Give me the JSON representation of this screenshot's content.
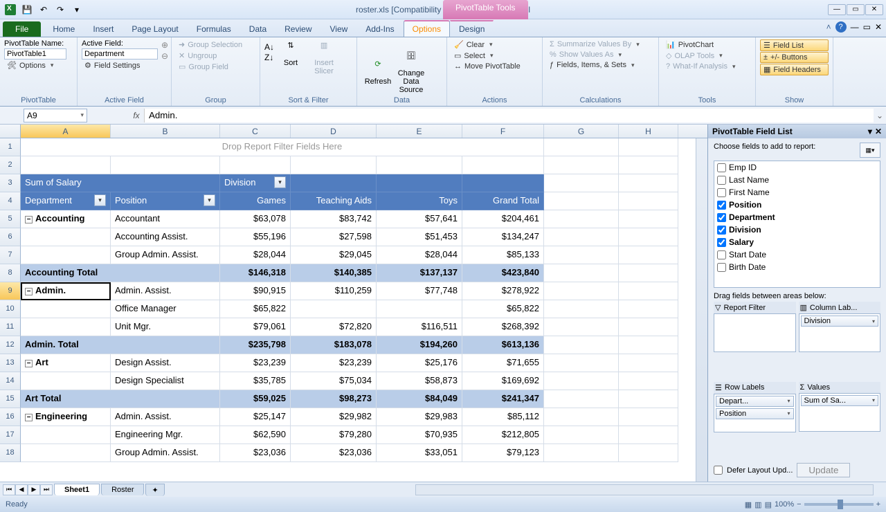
{
  "window": {
    "title": "roster.xls  [Compatibility Mode] - Microsoft Excel",
    "context_tab": "PivotTable Tools"
  },
  "tabs": {
    "file": "File",
    "items": [
      "Home",
      "Insert",
      "Page Layout",
      "Formulas",
      "Data",
      "Review",
      "View",
      "Add-Ins",
      "Options",
      "Design"
    ],
    "active": "Options"
  },
  "ribbon": {
    "pivottable": {
      "name_label": "PivotTable Name:",
      "name_value": "PivotTable1",
      "options": "Options",
      "group_label": "PivotTable"
    },
    "active_field": {
      "label": "Active Field:",
      "value": "Department",
      "settings": "Field Settings",
      "group_label": "Active Field"
    },
    "group": {
      "selection": "Group Selection",
      "ungroup": "Ungroup",
      "field": "Group Field",
      "group_label": "Group"
    },
    "sort_filter": {
      "sort": "Sort",
      "slicer": "Insert Slicer",
      "group_label": "Sort & Filter"
    },
    "data": {
      "refresh": "Refresh",
      "change": "Change Data Source",
      "group_label": "Data"
    },
    "actions": {
      "clear": "Clear",
      "select": "Select",
      "move": "Move PivotTable",
      "group_label": "Actions"
    },
    "calculations": {
      "summarize": "Summarize Values By",
      "show_as": "Show Values As",
      "fis": "Fields, Items, & Sets",
      "group_label": "Calculations"
    },
    "tools": {
      "chart": "PivotChart",
      "olap": "OLAP Tools",
      "whatif": "What-If Analysis",
      "group_label": "Tools"
    },
    "show": {
      "fieldlist": "Field List",
      "buttons": "+/- Buttons",
      "headers": "Field Headers",
      "group_label": "Show"
    }
  },
  "formula": {
    "namebox": "A9",
    "value": "Admin."
  },
  "columns": [
    "A",
    "B",
    "C",
    "D",
    "E",
    "F",
    "G",
    "H"
  ],
  "pivot": {
    "drop_filter": "Drop Report Filter Fields Here",
    "value_name": "Sum of Salary",
    "col_field": "Division",
    "row_field1": "Department",
    "row_field2": "Position",
    "cols": [
      "Games",
      "Teaching Aids",
      "Toys",
      "Grand Total"
    ],
    "rows": [
      {
        "n": 5,
        "grp": "Accounting",
        "pos": "Accountant",
        "v": [
          "$63,078",
          "$83,742",
          "$57,641",
          "$204,461"
        ]
      },
      {
        "n": 6,
        "pos": "Accounting Assist.",
        "v": [
          "$55,196",
          "$27,598",
          "$51,453",
          "$134,247"
        ]
      },
      {
        "n": 7,
        "pos": "Group Admin. Assist.",
        "v": [
          "$28,044",
          "$29,045",
          "$28,044",
          "$85,133"
        ]
      },
      {
        "n": 8,
        "total": "Accounting Total",
        "v": [
          "$146,318",
          "$140,385",
          "$137,137",
          "$423,840"
        ]
      },
      {
        "n": 9,
        "grp": "Admin.",
        "pos": "Admin. Assist.",
        "v": [
          "$90,915",
          "$110,259",
          "$77,748",
          "$278,922"
        ],
        "active": true
      },
      {
        "n": 10,
        "pos": "Office Manager",
        "v": [
          "$65,822",
          "",
          "",
          "$65,822"
        ]
      },
      {
        "n": 11,
        "pos": "Unit Mgr.",
        "v": [
          "$79,061",
          "$72,820",
          "$116,511",
          "$268,392"
        ]
      },
      {
        "n": 12,
        "total": "Admin. Total",
        "v": [
          "$235,798",
          "$183,078",
          "$194,260",
          "$613,136"
        ]
      },
      {
        "n": 13,
        "grp": "Art",
        "pos": "Design Assist.",
        "v": [
          "$23,239",
          "$23,239",
          "$25,176",
          "$71,655"
        ]
      },
      {
        "n": 14,
        "pos": "Design Specialist",
        "v": [
          "$35,785",
          "$75,034",
          "$58,873",
          "$169,692"
        ]
      },
      {
        "n": 15,
        "total": "Art Total",
        "v": [
          "$59,025",
          "$98,273",
          "$84,049",
          "$241,347"
        ]
      },
      {
        "n": 16,
        "grp": "Engineering",
        "pos": "Admin. Assist.",
        "v": [
          "$25,147",
          "$29,982",
          "$29,983",
          "$85,112"
        ]
      },
      {
        "n": 17,
        "pos": "Engineering Mgr.",
        "v": [
          "$62,590",
          "$79,280",
          "$70,935",
          "$212,805"
        ]
      },
      {
        "n": 18,
        "pos": "Group Admin. Assist.",
        "v": [
          "$23,036",
          "$23,036",
          "$33,051",
          "$79,123"
        ]
      }
    ]
  },
  "sheets": {
    "active": "Sheet1",
    "others": [
      "Roster"
    ]
  },
  "status": {
    "ready": "Ready",
    "zoom": "100%"
  },
  "field_list": {
    "title": "PivotTable Field List",
    "instruction": "Choose fields to add to report:",
    "fields": [
      {
        "name": "Emp ID",
        "checked": false
      },
      {
        "name": "Last Name",
        "checked": false
      },
      {
        "name": "First Name",
        "checked": false
      },
      {
        "name": "Position",
        "checked": true
      },
      {
        "name": "Department",
        "checked": true
      },
      {
        "name": "Division",
        "checked": true
      },
      {
        "name": "Salary",
        "checked": true
      },
      {
        "name": "Start Date",
        "checked": false
      },
      {
        "name": "Birth Date",
        "checked": false
      }
    ],
    "drag_label": "Drag fields between areas below:",
    "areas": {
      "report_filter": "Report Filter",
      "col_labels": "Column Lab...",
      "row_labels": "Row Labels",
      "values": "Values"
    },
    "chips": {
      "col": "Division",
      "row1": "Depart...",
      "row2": "Position",
      "val": "Sum of Sa..."
    },
    "defer": "Defer Layout Upd...",
    "update": "Update"
  }
}
